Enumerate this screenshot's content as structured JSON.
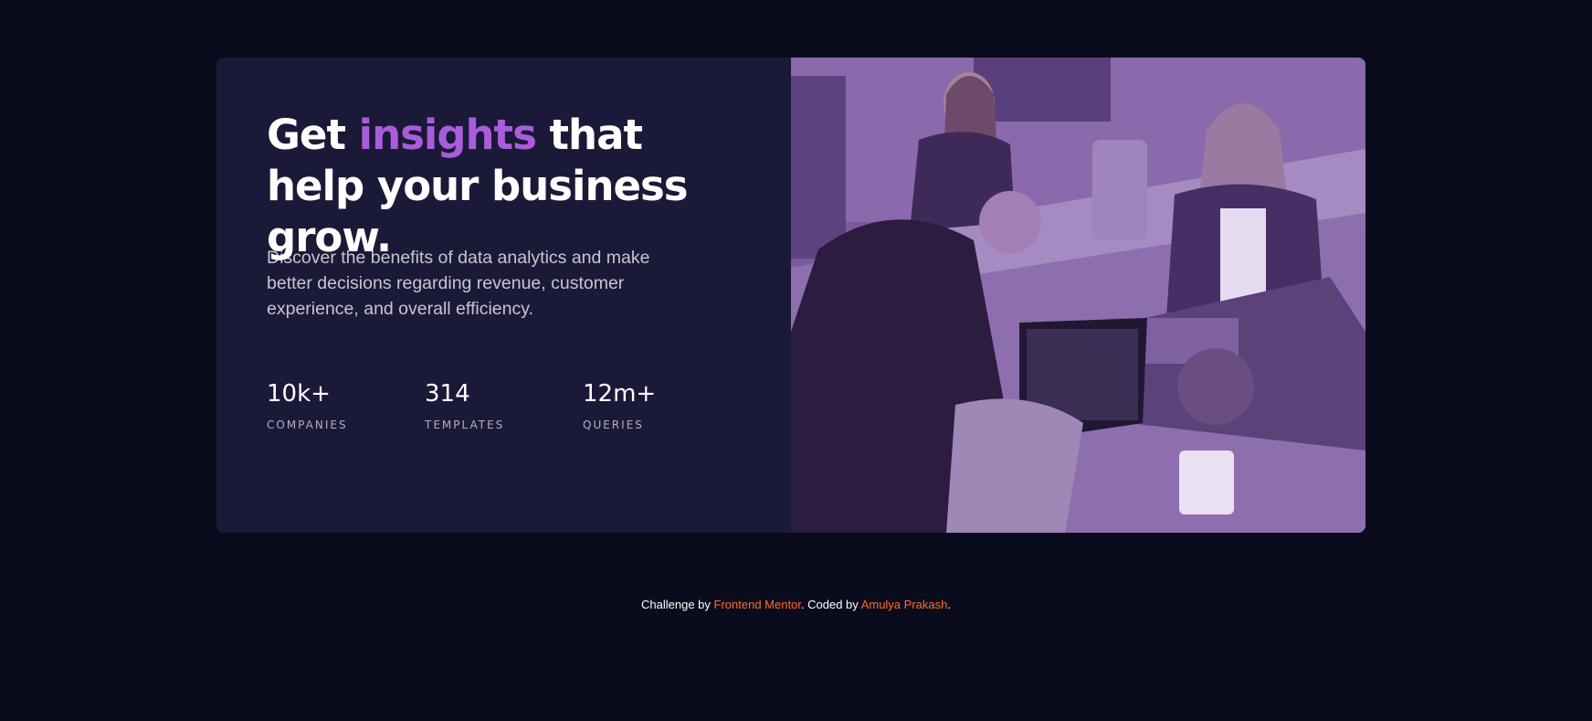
{
  "hero": {
    "headline_before": "Get ",
    "headline_accent": "insights",
    "headline_after": " that help your business grow.",
    "description": "Discover the benefits of data analytics and make better decisions regarding revenue, customer experience, and overall efficiency."
  },
  "stats": [
    {
      "value": "10k+",
      "label": "COMPANIES"
    },
    {
      "value": "314",
      "label": "TEMPLATES"
    },
    {
      "value": "12m+",
      "label": "QUERIES"
    }
  ],
  "image": {
    "icon": "office-team-photo"
  },
  "footer": {
    "prefix": "Challenge by ",
    "challenge_link": "Frontend Mentor",
    "middle": ". Coded by ",
    "author_link": "Amulya Prakash",
    "suffix": "."
  },
  "colors": {
    "page_background": "#0a0c1d",
    "card_background": "#1b1938",
    "accent": "#a95ddb",
    "image_tint": "#7a5a9d",
    "link": "#ff6a2b"
  }
}
